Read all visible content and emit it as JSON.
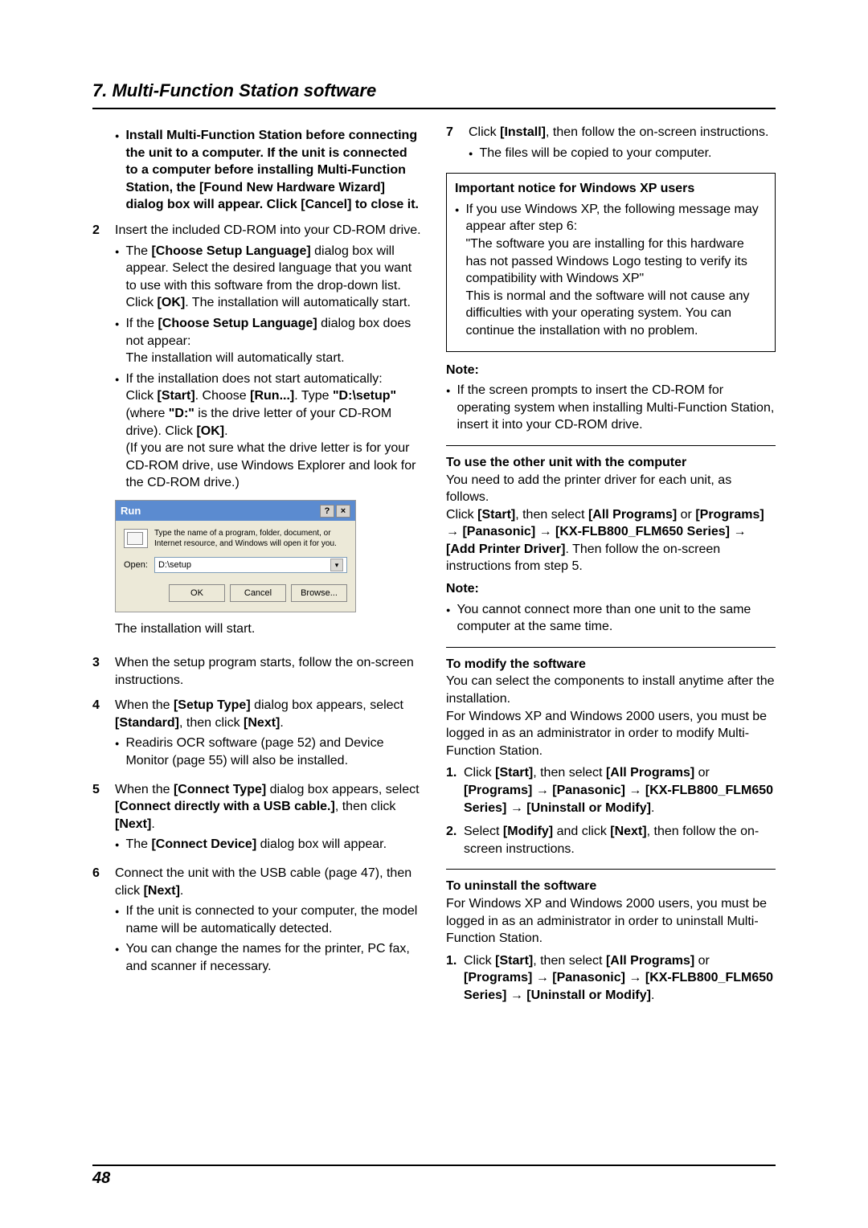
{
  "section_title": "7. Multi-Function Station software",
  "page_number": "48",
  "left": {
    "warn_text": "Install Multi-Function Station before connecting the unit to a computer. If the unit is connected to a computer before installing Multi-Function Station, the [Found New Hardware Wizard] dialog box will appear. Click [Cancel] to close it.",
    "step2": {
      "num": "2",
      "text": "Insert the included CD-ROM into your CD-ROM drive.",
      "b1_a": "The ",
      "b1_b": "[Choose Setup Language]",
      "b1_c": " dialog box will appear. Select the desired language that you want to use with this software from the drop-down list. Click ",
      "b1_d": "[OK]",
      "b1_e": ". The installation will automatically start.",
      "b2_a": "If the ",
      "b2_b": "[Choose Setup Language]",
      "b2_c": " dialog box does not appear:",
      "b2_d": "The installation will automatically start.",
      "b3_a": "If the installation does not start automatically:",
      "b3_b": "Click ",
      "b3_c": "[Start]",
      "b3_d": ". Choose ",
      "b3_e": "[Run...]",
      "b3_f": ". Type ",
      "b3_g": "\"D:\\setup\"",
      "b3_h": " (where ",
      "b3_i": "\"D:\"",
      "b3_j": " is the drive letter of your CD-ROM drive). Click ",
      "b3_k": "[OK]",
      "b3_l": ".",
      "b3_m": "(If you are not sure what the drive letter is for your CD-ROM drive, use Windows Explorer and look for the CD-ROM drive.)",
      "post_dialog": "The installation will start."
    },
    "run": {
      "title": "Run",
      "desc": "Type the name of a program, folder, document, or Internet resource, and Windows will open it for you.",
      "open_label": "Open:",
      "open_value": "D:\\setup",
      "ok": "OK",
      "cancel": "Cancel",
      "browse": "Browse..."
    },
    "step3": {
      "num": "3",
      "text": "When the setup program starts, follow the on-screen instructions."
    },
    "step4": {
      "num": "4",
      "a": "When the ",
      "b": "[Setup Type]",
      "c": " dialog box appears, select ",
      "d": "[Standard]",
      "e": ", then click ",
      "f": "[Next]",
      "g": ".",
      "bullet": "Readiris OCR software (page 52) and Device Monitor (page 55) will also be installed."
    },
    "step5": {
      "num": "5",
      "a": "When the ",
      "b": "[Connect Type]",
      "c": " dialog box appears, select ",
      "d": "[Connect directly with a USB cable.]",
      "e": ", then click ",
      "f": "[Next]",
      "g": ".",
      "bullet_a": "The ",
      "bullet_b": "[Connect Device]",
      "bullet_c": " dialog box will appear."
    },
    "step6": {
      "num": "6",
      "a": "Connect the unit with the USB cable (page 47), then click ",
      "b": "[Next]",
      "c": ".",
      "bullet1": "If the unit is connected to your computer, the model name will be automatically detected.",
      "bullet2": "You can change the names for the printer, PC fax, and scanner if necessary."
    }
  },
  "right": {
    "step7": {
      "num": "7",
      "a": "Click ",
      "b": "[Install]",
      "c": ", then follow the on-screen instructions.",
      "bullet": "The files will be copied to your computer."
    },
    "notice": {
      "title": "Important notice for Windows XP users",
      "a": "If you use Windows XP, the following message may appear after step 6:",
      "b": "\"The software you are installing for this hardware has not passed Windows Logo testing to verify its compatibility with Windows XP\"",
      "c": "This is normal and the software will not cause any difficulties with your operating system. You can continue the installation with no problem."
    },
    "note1": {
      "hd": "Note:",
      "text": "If the screen prompts to insert the CD-ROM for operating system when installing Multi-Function Station, insert it into your CD-ROM drive."
    },
    "sec_use": {
      "title": "To use the other unit with the computer",
      "p1": "You need to add the printer driver for each unit, as follows.",
      "p2_a": "Click ",
      "p2_b": "[Start]",
      "p2_c": ", then select ",
      "p2_d": "[All Programs]",
      "p2_e": " or ",
      "p2_f": "[Programs]",
      "p2_g": "[Panasonic]",
      "p2_h": "[KX-FLB800_FLM650 Series]",
      "p2_i": "[Add Printer Driver]",
      "p2_j": ". Then follow the on-screen instructions from step 5.",
      "note_hd": "Note:",
      "note_text": "You cannot connect more than one unit to the same computer at the same time."
    },
    "sec_modify": {
      "title": "To modify the software",
      "p1": "You can select the components to install anytime after the installation.",
      "p2": "For Windows XP and Windows 2000 users, you must be logged in as an administrator in order to modify Multi-Function Station.",
      "li1_a": "Click ",
      "li1_b": "[Start]",
      "li1_c": ", then select ",
      "li1_d": "[All Programs]",
      "li1_e": " or ",
      "li1_f": "[Programs]",
      "li1_g": "[Panasonic]",
      "li1_h": "[KX-FLB800_FLM650 Series]",
      "li1_i": "[Uninstall or Modify]",
      "li1_j": ".",
      "li2_a": "Select ",
      "li2_b": "[Modify]",
      "li2_c": " and click ",
      "li2_d": "[Next]",
      "li2_e": ", then follow the on-screen instructions."
    },
    "sec_uninstall": {
      "title": "To uninstall the software",
      "p1": "For Windows XP and Windows 2000 users, you must be logged in as an administrator in order to uninstall Multi-Function Station.",
      "li1_a": "Click ",
      "li1_b": "[Start]",
      "li1_c": ", then select ",
      "li1_d": "[All Programs]",
      "li1_e": " or ",
      "li1_f": "[Programs]",
      "li1_g": "[Panasonic]",
      "li1_h": "[KX-FLB800_FLM650 Series]",
      "li1_i": "[Uninstall or Modify]",
      "li1_j": "."
    }
  }
}
